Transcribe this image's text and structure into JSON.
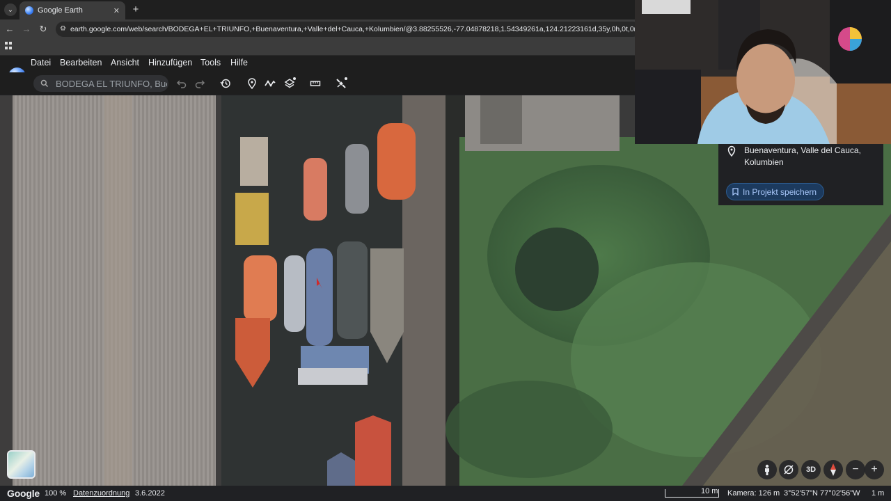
{
  "browser": {
    "tab_title": "Google Earth",
    "tab_close": "✕",
    "new_tab": "+",
    "url": "earth.google.com/web/search/BODEGA+EL+TRIUNFO,+Buenaventura,+Valle+del+Cauca,+Kolumbien/@3.88255526,-77.04878218,1.54349261a,124.21223161d,35y,0h,0t,0r/data=CqoBGnwSdgolM"
  },
  "menu": {
    "items": [
      "Datei",
      "Bearbeiten",
      "Ansicht",
      "Hinzufügen",
      "Tools",
      "Hilfe"
    ]
  },
  "toolbar": {
    "search_value": "BODEGA EL TRIUNFO, Bue",
    "tools": [
      "undo-icon",
      "redo-icon",
      "history-icon",
      "placemark-icon",
      "path-icon",
      "layers-icon",
      "ruler-icon",
      "satellite-icon"
    ]
  },
  "info_card": {
    "location_line1": "Buenaventura, Valle del Cauca,",
    "location_line2": "Kolumbien",
    "save_label": "In Projekt speichern"
  },
  "controls": {
    "three_d_label": "3D",
    "zoom_out": "−",
    "zoom_in": "+"
  },
  "status": {
    "logo": "Google",
    "zoom_percent": "100 %",
    "attribution": "Datenzuordnung",
    "imagery_date": "3.6.2022",
    "scale": "10 m",
    "camera": "Kamera: 126 m",
    "coordinates": "3°52'57\"N 77°02'56\"W",
    "altitude": "1 m"
  },
  "colors": {
    "accent_button_bg": "#1c3a5e",
    "accent_button_text": "#a8c7fa"
  }
}
